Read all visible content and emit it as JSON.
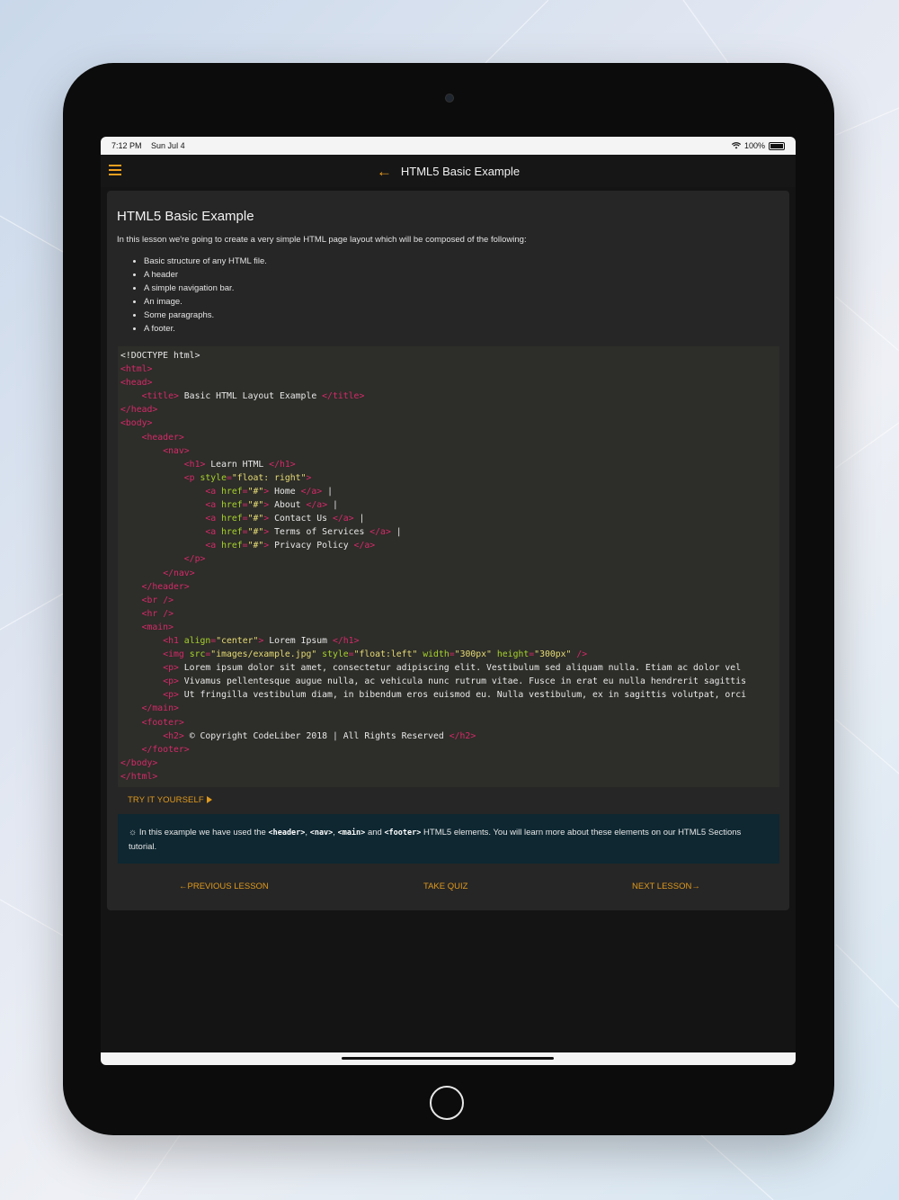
{
  "status_bar": {
    "time": "7:12 PM",
    "date": "Sun Jul 4",
    "battery": "100%"
  },
  "nav": {
    "title": "HTML5 Basic Example"
  },
  "lesson": {
    "heading": "HTML5 Basic Example",
    "intro": "In this lesson we're going to create a very simple HTML page layout which will be composed of the following:",
    "bullets": [
      "Basic structure of any HTML file.",
      "A header",
      "A simple navigation bar.",
      "An image.",
      "Some paragraphs.",
      "A footer."
    ]
  },
  "code": {
    "lines": [
      "<!DOCTYPE html>",
      "<html>",
      "<head>",
      "    <title> Basic HTML Layout Example </title>",
      "</head>",
      "<body>",
      "    <header>",
      "        <nav>",
      "            <h1> Learn HTML </h1>",
      "            <p style=\"float: right\">",
      "                <a href=\"#\"> Home </a> |",
      "                <a href=\"#\"> About </a> |",
      "                <a href=\"#\"> Contact Us </a> |",
      "                <a href=\"#\"> Terms of Services </a> |",
      "                <a href=\"#\"> Privacy Policy </a>",
      "            </p>",
      "        </nav>",
      "    </header>",
      "    <br />",
      "    <hr />",
      "    <main>",
      "        <h1 align=\"center\"> Lorem Ipsum </h1>",
      "        <img src=\"images/example.jpg\" style=\"float:left\" width=\"300px\" height=\"300px\" />",
      "        <p> Lorem ipsum dolor sit amet, consectetur adipiscing elit. Vestibulum sed aliquam nulla. Etiam ac dolor vel",
      "        <p> Vivamus pellentesque augue nulla, ac vehicula nunc rutrum vitae. Fusce in erat eu nulla hendrerit sagittis",
      "        <p> Ut fringilla vestibulum diam, in bibendum eros euismod eu. Nulla vestibulum, ex in sagittis volutpat, orci",
      "    </main>",
      "    <footer>",
      "        <h2> © Copyright CodeLiber 2018 | All Rights Reserved </h2>",
      "    </footer>",
      "</body>",
      "</html>"
    ]
  },
  "try_it": {
    "label": "TRY IT YOURSELF"
  },
  "note": {
    "prefix": "In this example we have used the",
    "tags": [
      "<header>",
      "<nav>",
      "<main>",
      "<footer>"
    ],
    "sep1": ",",
    "sep2": ",",
    "sep3": "and",
    "suffix": "HTML5 elements. You will learn more about these elements on our HTML5 Sections tutorial."
  },
  "lesson_nav": {
    "previous": "←PREVIOUS LESSON",
    "quiz": "TAKE QUIZ",
    "next": "NEXT LESSON→"
  },
  "colors": {
    "accent": "#f0a020",
    "tag": "#d52a68",
    "attr": "#a6d22c",
    "string": "#e6db74",
    "note_bg": "#0e2731"
  },
  "icons": {
    "menu": "hamburger-icon",
    "back": "arrow-left-icon",
    "note": "lightbulb-icon"
  }
}
